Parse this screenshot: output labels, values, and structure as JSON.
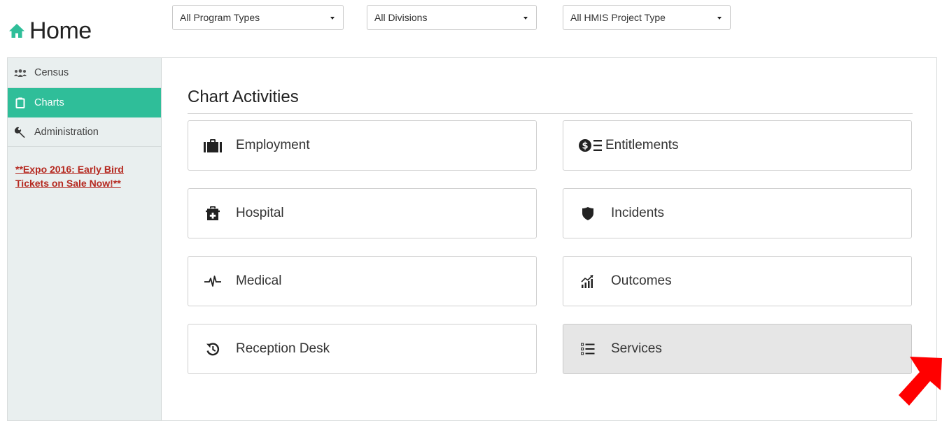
{
  "header": {
    "title": "Home",
    "filters": [
      {
        "selected": "All Program Types"
      },
      {
        "selected": "All Divisions"
      },
      {
        "selected": "All HMIS Project Type"
      }
    ]
  },
  "sidebar": {
    "items": [
      {
        "label": "Census",
        "icon": "group-icon",
        "active": false
      },
      {
        "label": "Charts",
        "icon": "clipboard-icon",
        "active": true
      },
      {
        "label": "Administration",
        "icon": "wrench-icon",
        "active": false
      }
    ],
    "promo_link": "**Expo 2016: Early Bird Tickets on Sale Now!**"
  },
  "main": {
    "section_title": "Chart Activities",
    "cards": [
      {
        "label": "Employment",
        "icon": "briefcase-icon"
      },
      {
        "label": "Entitlements",
        "icon": "money-list-icon"
      },
      {
        "label": "Hospital",
        "icon": "medkit-icon"
      },
      {
        "label": "Incidents",
        "icon": "shield-icon"
      },
      {
        "label": "Medical",
        "icon": "heartbeat-icon"
      },
      {
        "label": "Outcomes",
        "icon": "bar-chart-icon"
      },
      {
        "label": "Reception Desk",
        "icon": "history-icon"
      },
      {
        "label": "Services",
        "icon": "list-icon",
        "selected": true
      }
    ]
  },
  "colors": {
    "accent": "#2fbe99",
    "promo": "#b5281f",
    "sidebar_bg": "#e9efef",
    "selected_card_bg": "#e6e6e6",
    "cursor": "#ff0000"
  }
}
